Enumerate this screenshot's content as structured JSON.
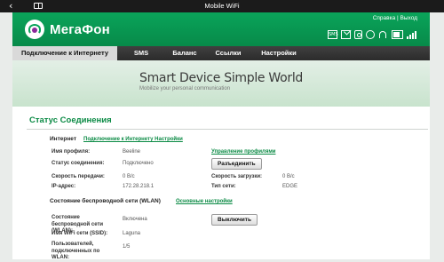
{
  "topbar": {
    "title": "Mobile WiFi",
    "back_icon": "‹"
  },
  "header": {
    "brand": "МегаФон",
    "links": {
      "help": "Справка",
      "sep": "|",
      "logout": "Выход"
    },
    "icons": [
      "sms-icon",
      "mail-icon",
      "instagram-icon",
      "globe-icon",
      "wifi-icon",
      "battery-icon",
      "signal-icon"
    ],
    "sms_text": "SMS"
  },
  "nav": {
    "tabs": [
      {
        "label": "Подключение к Интернету",
        "active": true
      },
      {
        "label": "SMS"
      },
      {
        "label": "Баланс"
      },
      {
        "label": "Ссылки"
      },
      {
        "label": "Настройки"
      }
    ]
  },
  "banner": {
    "slogan": "Smart Device   Simple World",
    "sub": "Mobilize your personal communication"
  },
  "status": {
    "title": "Статус Соединения",
    "internet": {
      "heading": "Интернет",
      "settings_link": "Подключение к Интернету Настройки",
      "profile_label": "Имя профиля:",
      "profile_value": "Beeline",
      "profiles_link": "Управление профилями",
      "conn_label": "Статус соединения:",
      "conn_value": "Подключено",
      "disconnect_btn": "Разъединить",
      "tx_label": "Скорость передачи:",
      "tx_value": "0 B/c",
      "rx_label": "Скорость загрузки:",
      "rx_value": "0 B/c",
      "ip_label": "IP-адрес:",
      "ip_value": "172.28.218.1",
      "nettype_label": "Тип сети:",
      "nettype_value": "EDGE"
    },
    "wlan": {
      "heading": "Состояние беспроводной сети (WLAN)",
      "settings_link": "Основные настройки",
      "state_label": "Состояние беспроводной сети (WLAN):",
      "state_value": "Включена",
      "off_btn": "Выключить",
      "ssid_label": "Имя WiFi сети (SSID):",
      "ssid_value": "Laguna",
      "users_label": "Пользователей, подключенных по WLAN:",
      "users_value": "1/5"
    }
  },
  "colors": {
    "brand_green": "#0aa45a",
    "link_green": "#0a8a44",
    "nav_dark": "#333333"
  }
}
